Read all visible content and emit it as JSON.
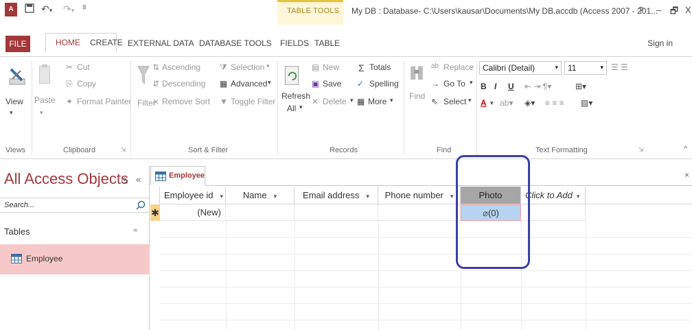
{
  "titlebar": {
    "app_icon": "A",
    "table_tools": "TABLE TOOLS",
    "title": "My DB : Database- C:\\Users\\kausar\\Documents\\My DB.accdb (Access 2007 - 201...",
    "help": "?",
    "minimize": "–",
    "restore": "🗗",
    "close": "X"
  },
  "tabs": {
    "file": "FILE",
    "home": "HOME",
    "create": "CREATE",
    "external_data": "EXTERNAL DATA",
    "database_tools": "DATABASE TOOLS",
    "fields": "FIELDS",
    "table": "TABLE",
    "sign_in": "Sign in"
  },
  "ribbon": {
    "views": {
      "view": "View",
      "label": "Views"
    },
    "clipboard": {
      "paste": "Paste",
      "cut": "Cut",
      "copy": "Copy",
      "format_painter": "Format Painter",
      "label": "Clipboard"
    },
    "sort_filter": {
      "filter": "Filter",
      "ascending": "Ascending",
      "descending": "Descending",
      "remove_sort": "Remove Sort",
      "selection": "Selection",
      "advanced": "Advanced",
      "toggle_filter": "Toggle Filter",
      "label": "Sort & Filter"
    },
    "records": {
      "refresh": "Refresh",
      "all": "All",
      "new": "New",
      "save": "Save",
      "delete": "Delete",
      "totals": "Totals",
      "spelling": "Spelling",
      "more": "More",
      "label": "Records"
    },
    "find": {
      "find": "Find",
      "replace": "Replace",
      "go_to": "Go To",
      "select": "Select",
      "label": "Find"
    },
    "text_formatting": {
      "font": "Calibri (Detail)",
      "size": "11",
      "bold": "B",
      "italic": "I",
      "underline": "U",
      "label": "Text Formatting"
    }
  },
  "nav": {
    "title": "All Access Objects",
    "search_placeholder": "Search...",
    "category": "Tables",
    "items": [
      {
        "label": "Employee"
      }
    ]
  },
  "document": {
    "tab_label": "Employee",
    "columns": [
      "Employee id",
      "Name",
      "Email address",
      "Phone number",
      "Photo",
      "Click to Add"
    ],
    "new_row": {
      "marker": "✱",
      "employee_id": "(New)",
      "photo": "(0)"
    }
  },
  "colors": {
    "accent": "#a4373a",
    "table_tools": "#e8c23a",
    "nav_selected": "#f7c8c9",
    "photo_selected": "#b6d4f2",
    "annotation": "#3a3faa"
  }
}
